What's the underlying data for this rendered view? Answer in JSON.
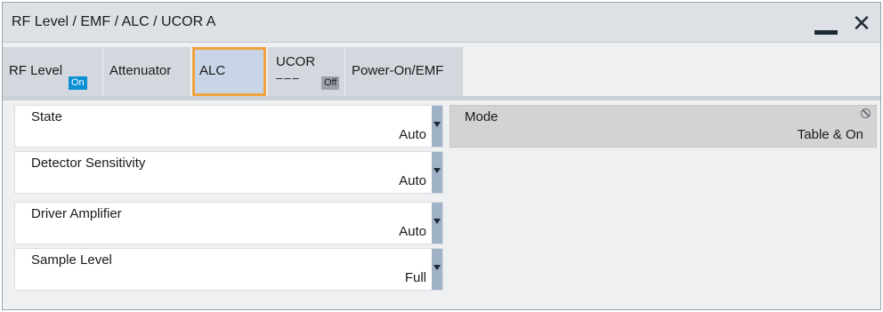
{
  "window": {
    "title": "RF Level / EMF / ALC / UCOR A",
    "minimize_icon": "minimize-icon",
    "close_label": "✕"
  },
  "tabs": [
    {
      "label": "RF Level",
      "badge": "On"
    },
    {
      "label": "Attenuator"
    },
    {
      "label": "ALC",
      "active": true
    },
    {
      "label": "UCOR",
      "sub": "–––",
      "badge": "Off"
    },
    {
      "label": "Power-On/EMF"
    }
  ],
  "fields": [
    {
      "name": "State",
      "value": "Auto"
    },
    {
      "name": "Detector Sensitivity",
      "value": "Auto"
    },
    {
      "name": "Driver Amplifier",
      "value": "Auto"
    },
    {
      "name": "Sample Level",
      "value": "Full"
    }
  ],
  "mode": {
    "name": "Mode",
    "value": "Table & On",
    "icon": "blocked-icon"
  },
  "colors": {
    "accent": "#f0a23c",
    "on_badge": "#0a8fd4",
    "dropdown": "#9fb2c6"
  }
}
